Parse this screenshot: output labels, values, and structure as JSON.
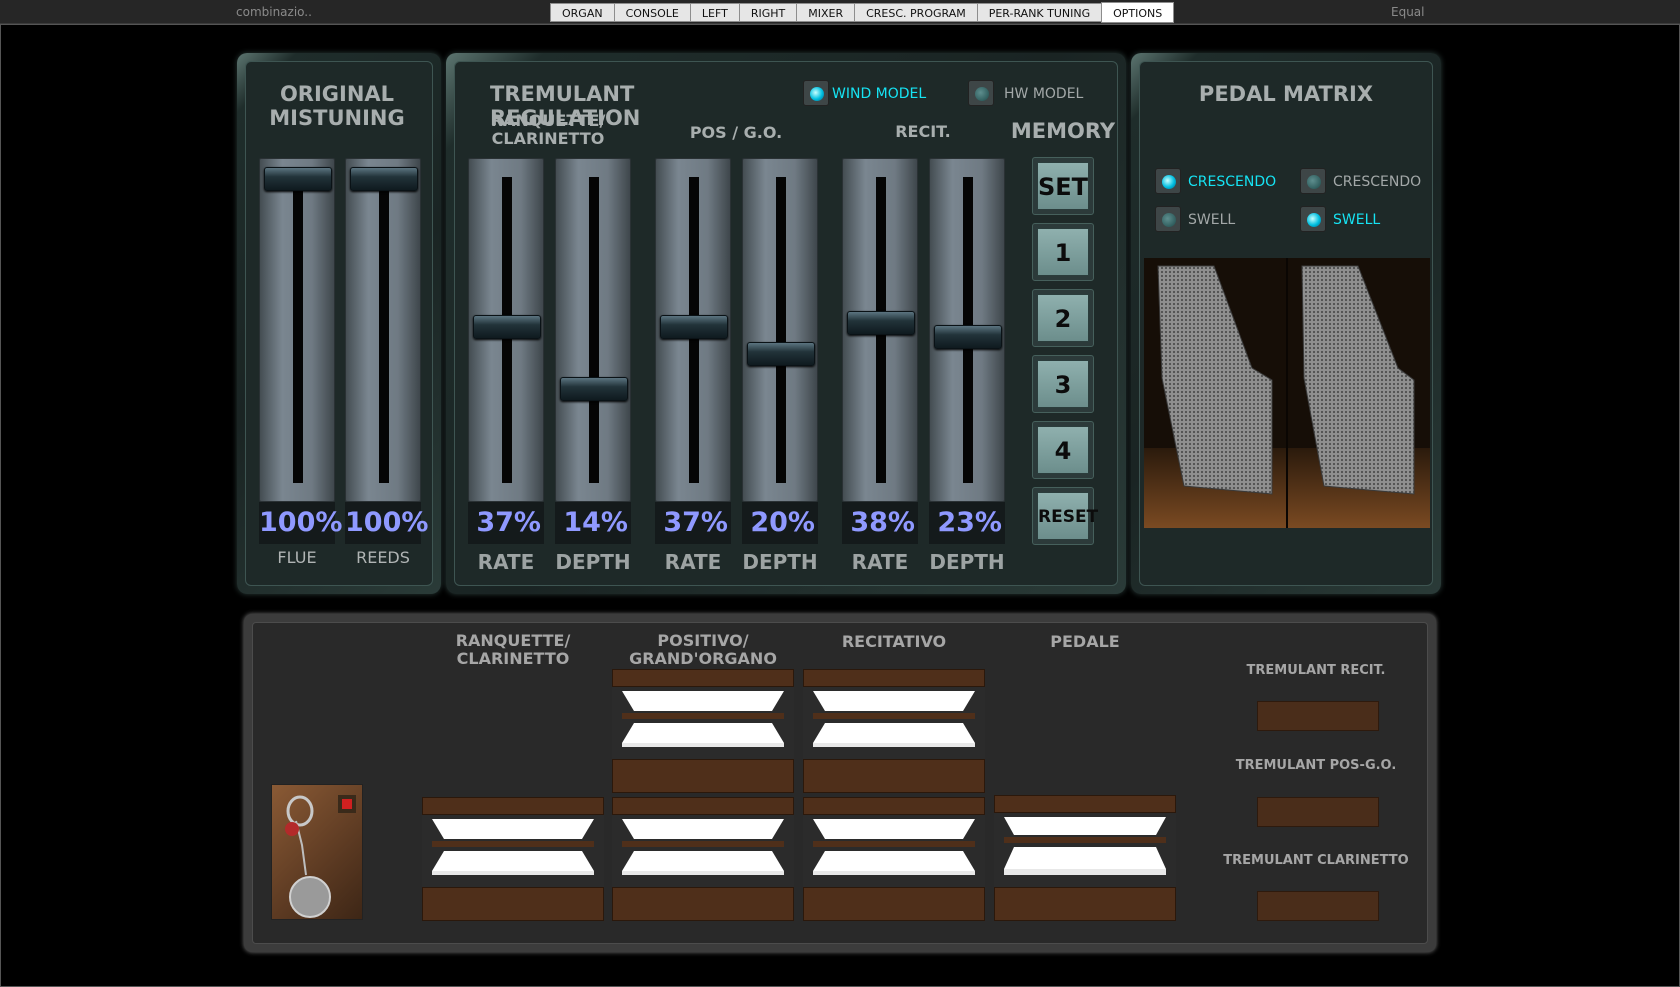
{
  "topbar": {
    "combination": "combinazio..",
    "temperament": "Equal",
    "tabs": [
      "ORGAN",
      "CONSOLE",
      "LEFT",
      "RIGHT",
      "MIXER",
      "CRESC. PROGRAM",
      "PER-RANK TUNING",
      "OPTIONS"
    ],
    "active_tab": "OPTIONS"
  },
  "mistuning": {
    "title_line1": "ORIGINAL",
    "title_line2": "MISTUNING",
    "sliders": [
      {
        "label": "FLUE",
        "value_text": "100%",
        "level": 1.0
      },
      {
        "label": "REEDS",
        "value_text": "100%",
        "level": 1.0
      }
    ]
  },
  "tremulant": {
    "title": "TREMULANT REGULATION",
    "wind_model_label": "WIND MODEL",
    "wind_model_on": true,
    "hw_model_label": "HW MODEL",
    "hw_model_on": false,
    "groups": [
      {
        "head_line1": "RANQUETTE/",
        "head_line2": "CLARINETTO",
        "rate": {
          "label": "RATE",
          "value_text": "37%",
          "level": 0.37
        },
        "depth": {
          "label": "DEPTH",
          "value_text": "14%",
          "level": 0.14
        }
      },
      {
        "head_line1": "POS / G.O.",
        "head_line2": "",
        "rate": {
          "label": "RATE",
          "value_text": "37%",
          "level": 0.37
        },
        "depth": {
          "label": "DEPTH",
          "value_text": "20%",
          "level": 0.2
        }
      },
      {
        "head_line1": "RECIT.",
        "head_line2": "",
        "rate": {
          "label": "RATE",
          "value_text": "38%",
          "level": 0.38
        },
        "depth": {
          "label": "DEPTH",
          "value_text": "23%",
          "level": 0.23
        }
      }
    ],
    "memory": {
      "title": "MEMORY",
      "buttons": [
        "SET",
        "1",
        "2",
        "3",
        "4",
        "RESET"
      ]
    }
  },
  "pedal_matrix": {
    "title": "PEDAL MATRIX",
    "left": [
      {
        "label": "CRESCENDO",
        "on": true
      },
      {
        "label": "SWELL",
        "on": false
      }
    ],
    "right": [
      {
        "label": "CRESCENDO",
        "on": false
      },
      {
        "label": "SWELL",
        "on": true
      }
    ]
  },
  "keyboards": {
    "columns": [
      {
        "title_line1": "RANQUETTE/",
        "title_line2": "CLARINETTO"
      },
      {
        "title_line1": "POSITIVO/",
        "title_line2": "GRAND'ORGANO"
      },
      {
        "title_line1": "RECITATIVO",
        "title_line2": ""
      },
      {
        "title_line1": "PEDALE",
        "title_line2": ""
      }
    ],
    "tremulant_switches": [
      "TREMULANT RECIT.",
      "TREMULANT POS-G.O.",
      "TREMULANT CLARINETTO"
    ]
  },
  "colors": {
    "accent_led": "#16e3f3",
    "percent_text": "#8f99ff",
    "wood": "#4f2f1a"
  }
}
